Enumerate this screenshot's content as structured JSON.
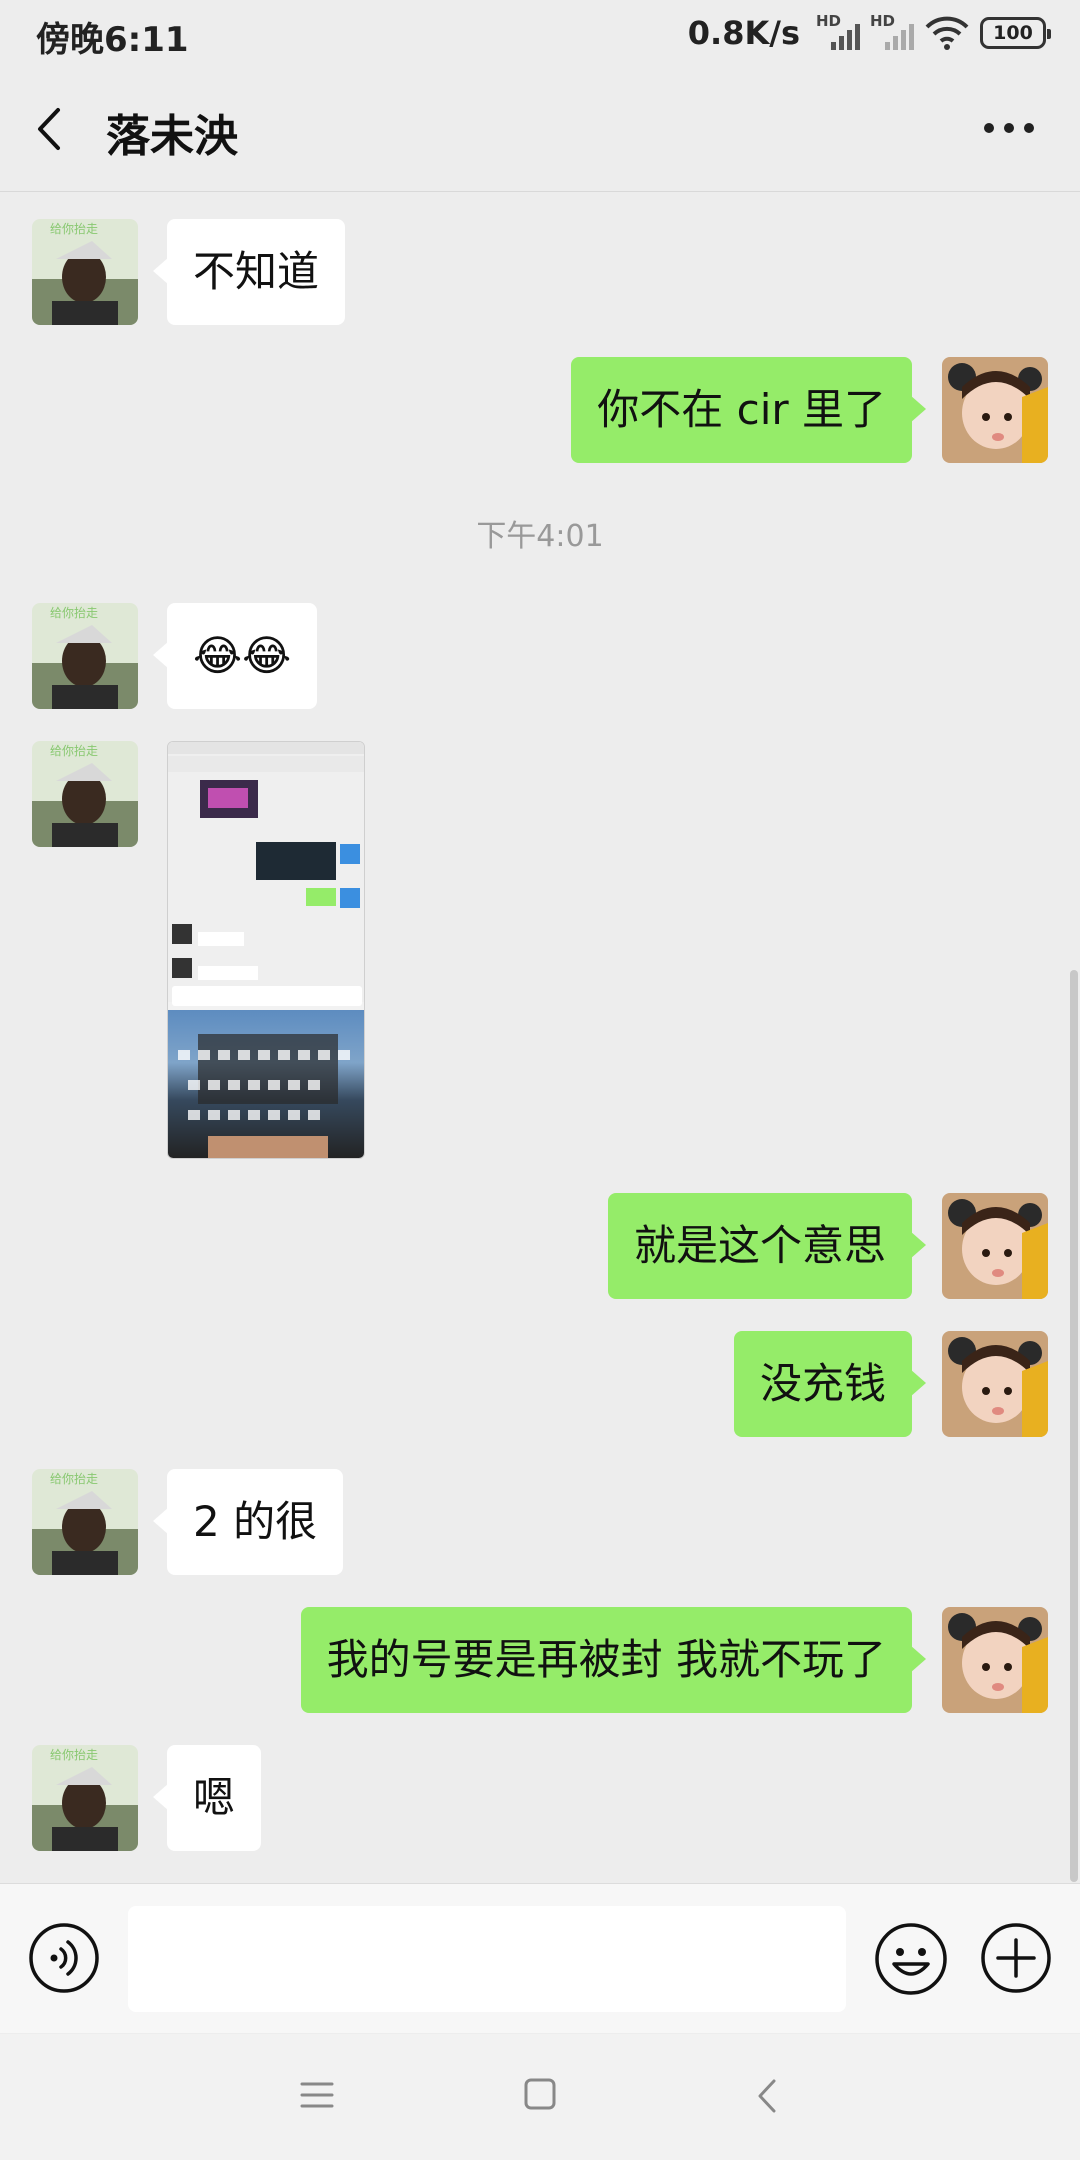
{
  "status_bar": {
    "time": "傍晚6:11",
    "net_speed": "0.8K/s",
    "signal1_label": "HD",
    "signal2_label": "HD",
    "battery": "100"
  },
  "header": {
    "title": "落未泱"
  },
  "messages": [
    {
      "side": "in",
      "text": "不知道"
    },
    {
      "side": "out",
      "text": "你不在 cir 里了"
    },
    {
      "timestamp": "下午4:01"
    },
    {
      "side": "in",
      "text": "😂😂"
    },
    {
      "side": "in",
      "type": "image"
    },
    {
      "side": "out",
      "text": "就是这个意思"
    },
    {
      "side": "out",
      "text": "没充钱"
    },
    {
      "side": "in",
      "text": "2 的很"
    },
    {
      "side": "out",
      "text": "我的号要是再被封 我就不玩了"
    },
    {
      "side": "in",
      "text": "嗯"
    }
  ],
  "avatars": {
    "incoming_watermark": "给你抬走"
  },
  "input_bar": {
    "placeholder": ""
  },
  "colors": {
    "background": "#ededed",
    "outgoing_bubble": "#95ec69",
    "incoming_bubble": "#ffffff"
  },
  "icons": [
    "back-arrow-icon",
    "more-icon",
    "voice-icon",
    "emoji-icon",
    "plus-icon",
    "menu-icon",
    "home-icon",
    "nav-back-icon"
  ]
}
